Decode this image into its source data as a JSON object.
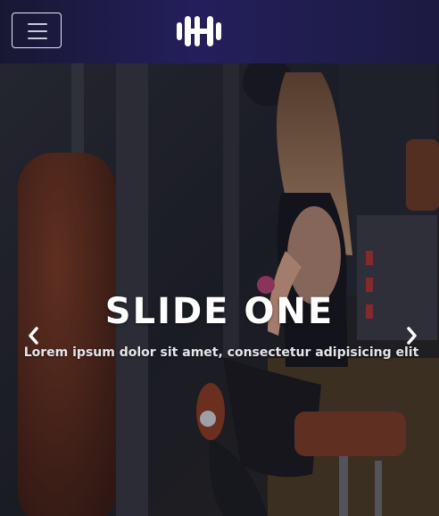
{
  "navbar": {
    "toggle_icon": "hamburger-menu-icon",
    "logo_icon": "dumbbell-logo-icon",
    "background": "#221e52"
  },
  "carousel": {
    "active_slide": {
      "title": "SLIDE ONE",
      "text": "Lorem ipsum dolor sit amet, consectetur adipisicing elit"
    },
    "prev_icon": "chevron-left-icon",
    "next_icon": "chevron-right-icon"
  }
}
